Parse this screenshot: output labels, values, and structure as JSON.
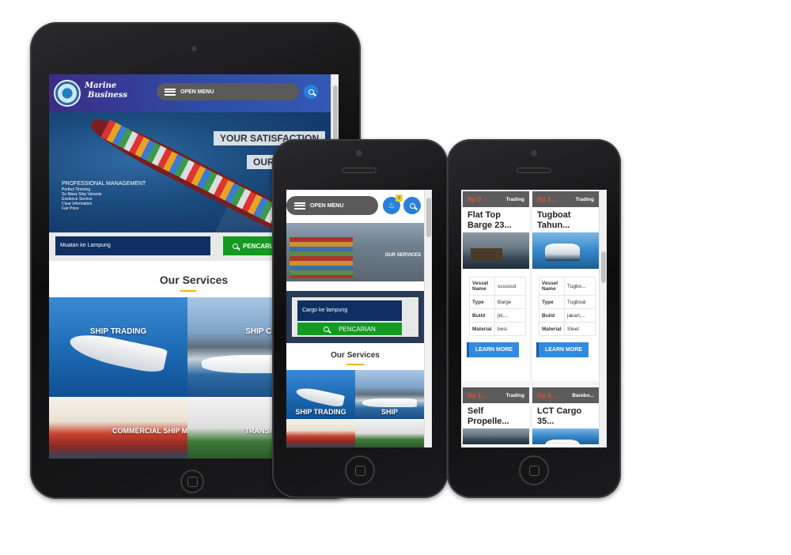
{
  "tablet": {
    "brand_line1": "Marine",
    "brand_line2": "Business",
    "menu_label": "OPEN MENU",
    "hero_banner_1": "YOUR SATISFACTION",
    "hero_banner_2": "OUR",
    "hero_heading": "PROFESSIONAL MANAGEMENT",
    "hero_points": [
      "Perfect Timming",
      "So Many Ship Variants",
      "Exelence Service",
      "Clear Information",
      "Fair Price"
    ],
    "search_value": "Muatan ke Lampung",
    "search_button": "PENCARIAN",
    "services_title": "Our Services",
    "services": [
      "SHIP TRADING",
      "SHIP CHARTER",
      "COMMERCIAL SHIP MANAGEMENT",
      "TRANSPORT"
    ]
  },
  "phone1": {
    "menu_label": "OPEN MENU",
    "badge": "0",
    "hero_caption": "OUR SERVICES",
    "search_value": "Cargo ke lampung",
    "search_button": "PENCARIAN",
    "services_title": "Our Services",
    "services": [
      "SHIP TRADING",
      "SHIP"
    ]
  },
  "phone2": {
    "listings": [
      {
        "price": "Rp 0",
        "category": "Trading",
        "title": "Flat Top Barge 23...",
        "specs": [
          [
            "Vessel Name",
            "ssssssd"
          ],
          [
            "Type",
            "Barge"
          ],
          [
            "Build",
            "jkt,..."
          ],
          [
            "Material",
            "besi"
          ]
        ],
        "cta": "LEARN MORE"
      },
      {
        "price": "Rp 1...",
        "category": "Trading",
        "title": "Tugboat Tahun...",
        "specs": [
          [
            "Vessel Name",
            "Tugbo..."
          ],
          [
            "Type",
            "Tugboat"
          ],
          [
            "Build",
            "jakart,..."
          ],
          [
            "Material",
            "Steel"
          ]
        ],
        "cta": "LEARN MORE"
      },
      {
        "price": "Rp 1...",
        "category": "Trading",
        "title": "Self Propelle..."
      },
      {
        "price": "Rp 5,...",
        "category": "Barebo...",
        "title": "LCT Cargo 35..."
      }
    ]
  },
  "colors": {
    "header_purple": "#3b2c86",
    "search_navy": "#0f2f63",
    "search_green": "#129a21",
    "accent_yellow": "#f2b600",
    "cta_blue": "#2f8ae0",
    "price_orange": "#e0542c"
  }
}
